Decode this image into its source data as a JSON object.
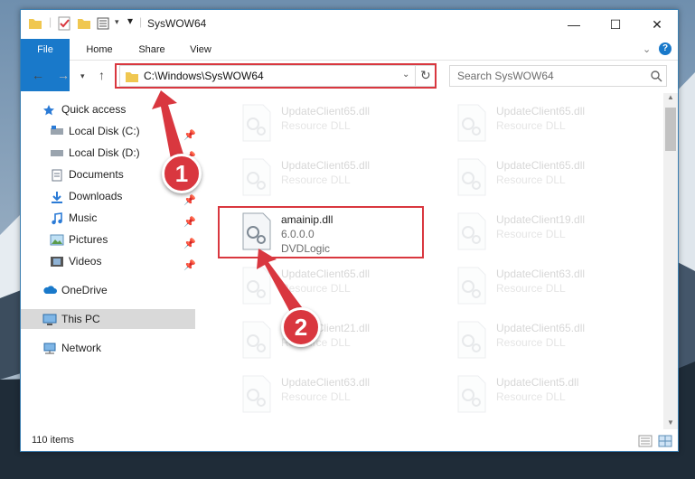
{
  "window": {
    "title": "SysWOW64"
  },
  "ribbon": {
    "tabs": [
      "File",
      "Home",
      "Share",
      "View"
    ]
  },
  "address": {
    "path": "C:\\Windows\\SysWOW64",
    "search_placeholder": "Search SysWOW64"
  },
  "sidebar": {
    "quick_access": "Quick access",
    "items": [
      {
        "label": "Local Disk (C:)",
        "icon": "drive-icon",
        "pinned": true
      },
      {
        "label": "Local Disk (D:)",
        "icon": "drive-icon",
        "pinned": true
      },
      {
        "label": "Documents",
        "icon": "documents-icon",
        "pinned": true
      },
      {
        "label": "Downloads",
        "icon": "downloads-icon",
        "pinned": true
      },
      {
        "label": "Music",
        "icon": "music-icon",
        "pinned": true
      },
      {
        "label": "Pictures",
        "icon": "pictures-icon",
        "pinned": true
      },
      {
        "label": "Videos",
        "icon": "videos-icon",
        "pinned": true
      }
    ],
    "onedrive": "OneDrive",
    "this_pc": "This PC",
    "network": "Network"
  },
  "files": [
    {
      "name": "UpdateClient65.dll",
      "type": "Resource DLL"
    },
    {
      "name": "UpdateClient65.dll",
      "type": "Resource DLL"
    },
    {
      "name": "UpdateClient65.dll",
      "type": "Resource DLL"
    },
    {
      "name": "UpdateClient65.dll",
      "type": "Resource DLL"
    },
    {
      "name": "amainip.dll",
      "version": "6.0.0.0",
      "company": "DVDLogic"
    },
    {
      "name": "UpdateClient19.dll",
      "type": "Resource DLL"
    },
    {
      "name": "UpdateClient65.dll",
      "type": "Resource DLL"
    },
    {
      "name": "UpdateClient63.dll",
      "type": "Resource DLL"
    },
    {
      "name": "UpdateClient21.dll",
      "type": "Resource DLL"
    },
    {
      "name": "UpdateClient65.dll",
      "type": "Resource DLL"
    },
    {
      "name": "UpdateClient63.dll",
      "type": "Resource DLL"
    },
    {
      "name": "UpdateClient5.dll",
      "type": "Resource DLL"
    }
  ],
  "status": {
    "item_count": "110 items"
  },
  "annotations": {
    "callout_1": "1",
    "callout_2": "2",
    "color": "#d9373f"
  }
}
